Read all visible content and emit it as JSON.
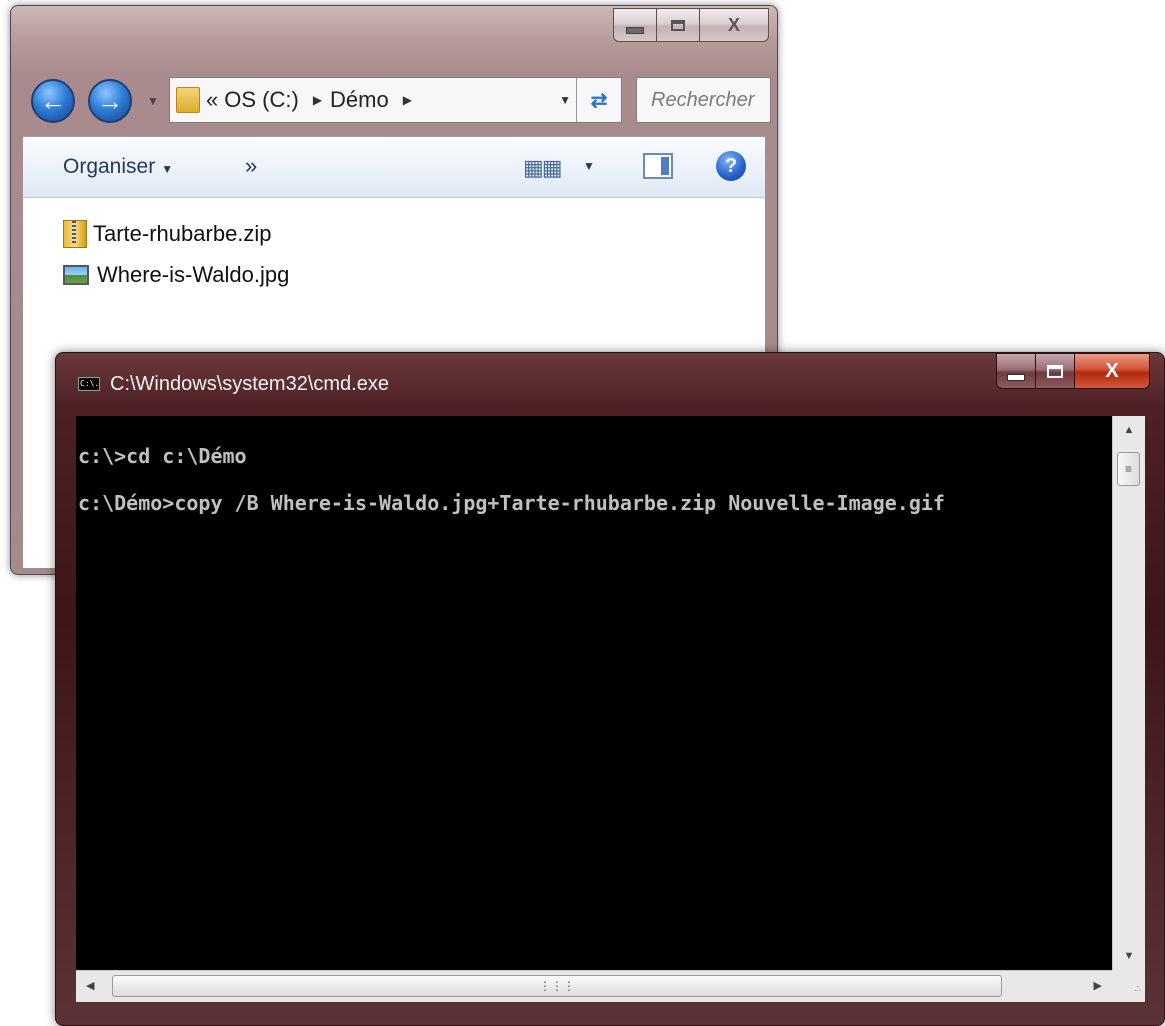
{
  "explorer": {
    "address": {
      "overflow": "«",
      "segments": [
        "OS (C:)",
        "Démo"
      ]
    },
    "search_placeholder": "Rechercher",
    "toolbar": {
      "organise_label": "Organiser",
      "more_label": "»"
    },
    "files": [
      {
        "name": "Tarte-rhubarbe.zip",
        "icon": "zip-folder-icon"
      },
      {
        "name": "Where-is-Waldo.jpg",
        "icon": "image-file-icon"
      }
    ],
    "caption": {
      "close_label": "X"
    }
  },
  "cmd": {
    "title": "C:\\Windows\\system32\\cmd.exe",
    "icon_text": "C:\\.",
    "close_label": "X",
    "lines": [
      "c:\\>cd c:\\Démo",
      "c:\\Démo>copy /B Where-is-Waldo.jpg+Tarte-rhubarbe.zip Nouvelle-Image.gif"
    ]
  },
  "icons": {
    "back": "back-arrow-icon",
    "forward": "forward-arrow-icon",
    "refresh": "refresh-icon",
    "views": "views-icon",
    "preview": "preview-pane-icon",
    "help": "help-icon"
  }
}
